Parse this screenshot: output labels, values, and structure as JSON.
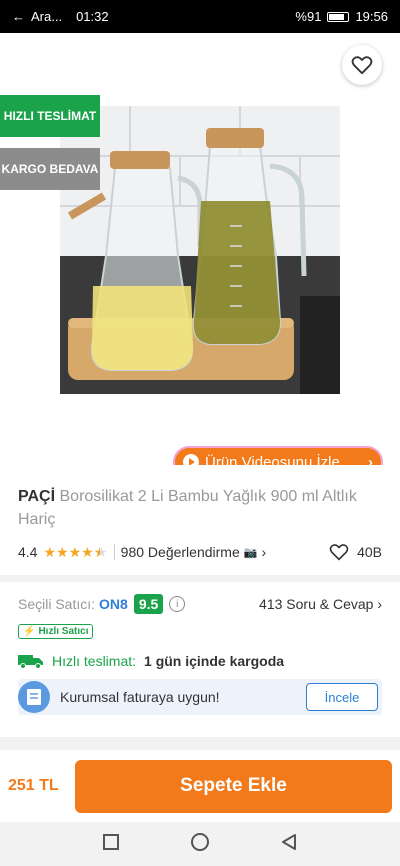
{
  "status_bar": {
    "back_app": "Ara...",
    "time_left": "01:32",
    "battery": "%91",
    "clock": "19:56"
  },
  "badges": {
    "fast_delivery": "HIZLI TESLİMAT",
    "free_shipping": "KARGO BEDAVA"
  },
  "video_button": {
    "label": "Ürün Videosunu İzle"
  },
  "product": {
    "brand": "PAÇİ",
    "name": "Borosilikat 2 Li Bambu Yağlık 900 ml Altlık Hariç",
    "rating": "4.4",
    "stars": 4.4,
    "reviews": "980 Değerlendirme",
    "likes": "40B"
  },
  "seller": {
    "label": "Seçili Satıcı:",
    "name": "ON8",
    "score": "9.5",
    "qa": "413 Soru & Cevap",
    "fast_seller": "Hızlı Satıcı"
  },
  "delivery": {
    "label": "Hızlı teslimat:",
    "value": "1 gün içinde kargoda"
  },
  "invoice": {
    "text": "Kurumsal faturaya uygun!",
    "button": "İncele"
  },
  "bottom": {
    "price": "251 TL",
    "add_to_cart": "Sepete Ekle"
  },
  "colors": {
    "accent": "#f27a1a",
    "green": "#1aa34a",
    "blue": "#2e7ed6"
  }
}
